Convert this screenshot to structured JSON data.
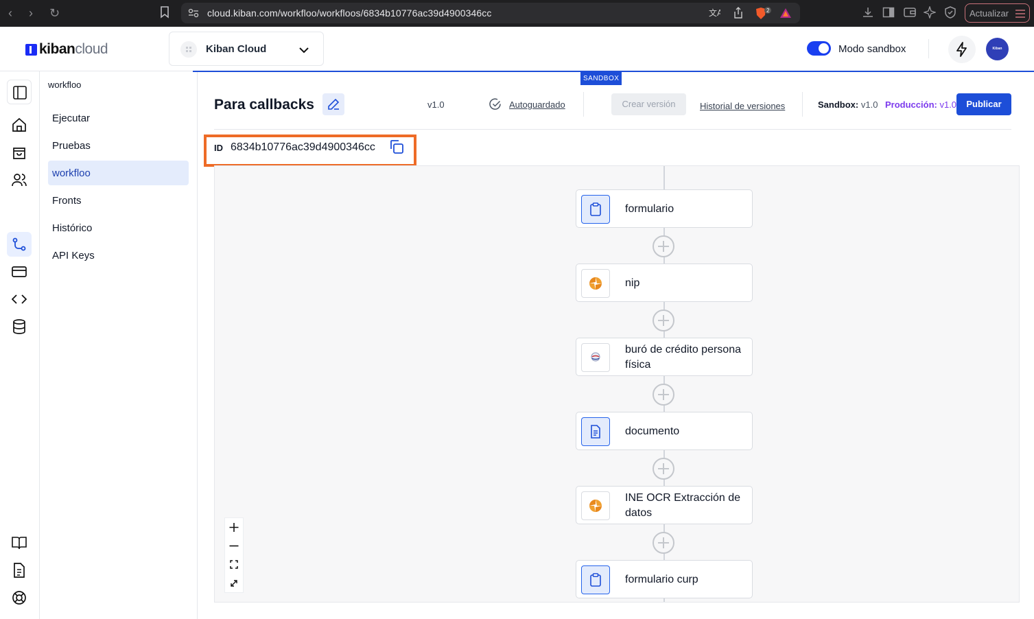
{
  "browser": {
    "url": "cloud.kiban.com/workfloo/workfloos/6834b10776ac39d4900346cc",
    "shield_count": "2",
    "update_label": "Actualizar"
  },
  "header": {
    "logo_bold": "kiban",
    "logo_light": "cloud",
    "org_name": "Kiban Cloud",
    "sandbox_mode_label": "Modo sandbox",
    "sandbox_mode_on": true,
    "avatar_text": "Kiban"
  },
  "subnav": {
    "title": "workfloo",
    "items": [
      {
        "label": "Ejecutar",
        "active": false
      },
      {
        "label": "Pruebas",
        "active": false
      },
      {
        "label": "workfloo",
        "active": true
      },
      {
        "label": "Fronts",
        "active": false
      },
      {
        "label": "Histórico",
        "active": false
      },
      {
        "label": "API Keys",
        "active": false
      }
    ]
  },
  "workflow": {
    "sandbox_tag": "SANDBOX",
    "title": "Para callbacks",
    "version": "v1.0",
    "autosave_label": "Autoguardado",
    "create_version_label": "Crear versión",
    "history_label": "Historial de versiones",
    "sandbox_version_label": "Sandbox:",
    "sandbox_version": "v1.0",
    "production_version_label": "Producción:",
    "production_version": "v1.0",
    "publish_label": "Publicar",
    "id_label": "ID",
    "id_value": "6834b10776ac39d4900346cc"
  },
  "nodes": [
    {
      "label": "formulario",
      "icon": "clipboard-icon"
    },
    {
      "label": "nip",
      "icon": "orange-pinwheel-icon"
    },
    {
      "label": "buró de crédito persona física",
      "icon": "buro-logo-icon"
    },
    {
      "label": "documento",
      "icon": "document-icon"
    },
    {
      "label": "INE OCR Extracción de datos",
      "icon": "orange-pinwheel-icon"
    },
    {
      "label": "formulario curp",
      "icon": "clipboard-icon"
    }
  ],
  "colors": {
    "accent": "#1d4ed8",
    "highlight_box": "#ee6b27",
    "production": "#7c3aed",
    "node_icon_orange": "#f0a030"
  }
}
